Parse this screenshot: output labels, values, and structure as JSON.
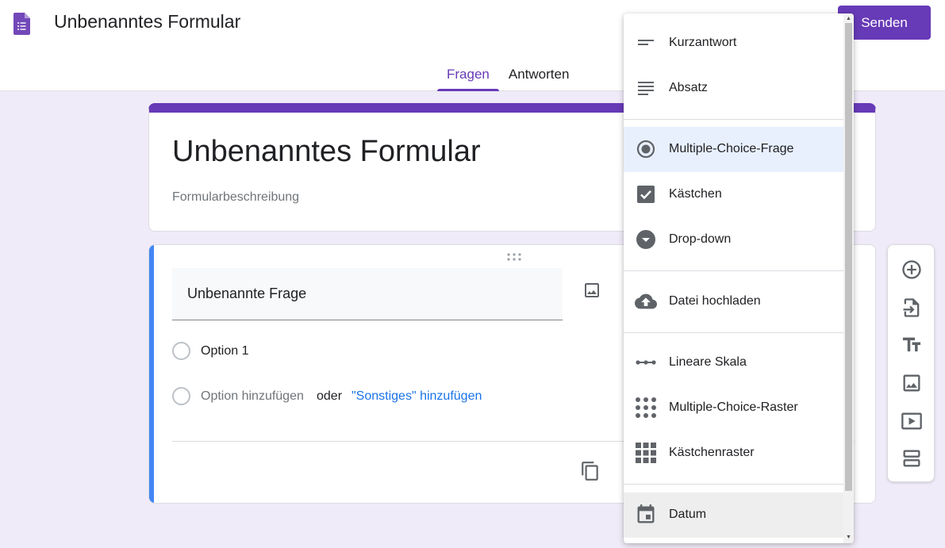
{
  "header": {
    "app_icon": "google-forms-icon",
    "doc_title": "Unbenanntes Formular",
    "tabs": [
      {
        "label": "Fragen",
        "active": true
      },
      {
        "label": "Antworten",
        "active": false
      }
    ],
    "send_label": "Senden"
  },
  "colors": {
    "theme": "#673ab7",
    "background": "#f0ebf8",
    "accent_blue": "#4285f4",
    "link": "#1a73e8"
  },
  "title_card": {
    "title": "Unbenanntes Formular",
    "description_placeholder": "Formularbeschreibung"
  },
  "question": {
    "title": "Unbenannte Frage",
    "options": [
      "Option 1"
    ],
    "add_option": "Option hinzufügen",
    "or": "oder",
    "add_other": "\"Sonstiges\" hinzufügen"
  },
  "side_toolbar": {
    "icons": [
      "add-question-icon",
      "import-questions-icon",
      "add-title-icon",
      "add-image-icon",
      "add-video-icon",
      "add-section-icon"
    ]
  },
  "type_menu": {
    "items": [
      {
        "label": "Kurzantwort",
        "icon": "short-answer-icon"
      },
      {
        "label": "Absatz",
        "icon": "paragraph-icon"
      },
      {
        "label": "Multiple-Choice-Frage",
        "icon": "radio-icon",
        "selected": true
      },
      {
        "label": "Kästchen",
        "icon": "checkbox-icon"
      },
      {
        "label": "Drop-down",
        "icon": "dropdown-icon"
      },
      {
        "label": "Datei hochladen",
        "icon": "cloud-upload-icon"
      },
      {
        "label": "Lineare Skala",
        "icon": "linear-scale-icon"
      },
      {
        "label": "Multiple-Choice-Raster",
        "icon": "grid-dots-icon"
      },
      {
        "label": "Kästchenraster",
        "icon": "grid-squares-icon"
      },
      {
        "label": "Datum",
        "icon": "calendar-icon",
        "hovered": true
      }
    ]
  }
}
